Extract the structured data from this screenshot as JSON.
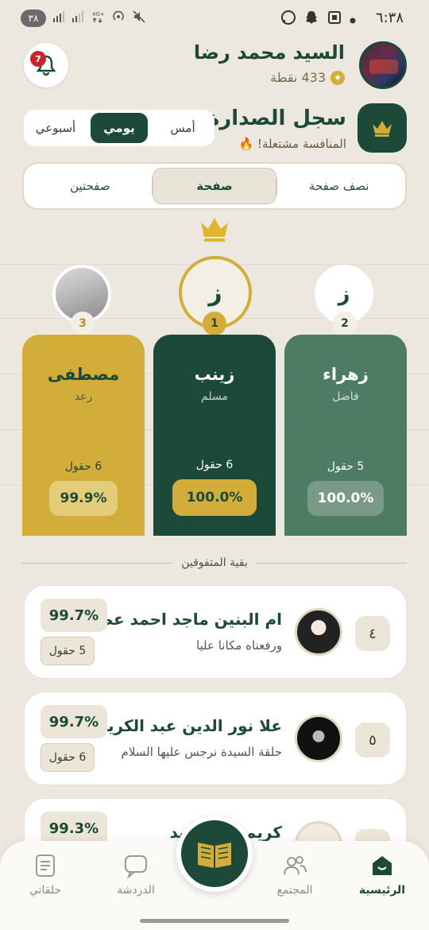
{
  "status_bar": {
    "time": "٦:٣٨",
    "battery": "٣٨"
  },
  "header": {
    "user_name": "السيد محمد رضا",
    "points": "433 نقطة",
    "notification_count": "7"
  },
  "leaderboard": {
    "title": "سجل الصدارة",
    "subtitle": "المنافسة مشتعلة! 🔥",
    "day_filters": [
      "أمس",
      "يومي",
      "أسبوعي"
    ],
    "day_active": "يومي",
    "amount_filters": [
      "نصف صفحة",
      "صفحة",
      "صفحتين"
    ],
    "amount_active": "صفحة"
  },
  "podium": [
    {
      "rank": "1",
      "initial": "ز",
      "name": "زينب",
      "circle": "مسلم",
      "fields": "6 حقول",
      "percent": "100.0%"
    },
    {
      "rank": "2",
      "initial": "ز",
      "name": "زهراء",
      "circle": "فاضل",
      "fields": "5 حقول",
      "percent": "100.0%"
    },
    {
      "rank": "3",
      "initial": "",
      "name": "مصطفى",
      "circle": "رعد",
      "fields": "6 حقول",
      "percent": "99.9%"
    }
  ],
  "rest_label": "بقية المتفوقين",
  "list": [
    {
      "rank": "٤",
      "name": "ام البنين ماجد احمد عطية",
      "circle": "ورفعناه مكانا عليا",
      "percent": "99.7%",
      "fields": "5 حقول"
    },
    {
      "rank": "٥",
      "name": "علا نور الدين عبد الكريم ...",
      "circle": "حلقة السيدة نرجس عليها السلام",
      "percent": "99.7%",
      "fields": "6 حقول"
    },
    {
      "rank": "",
      "name": "كريمة ... حميد",
      "circle": "",
      "percent": "99.3%",
      "fields": ""
    }
  ],
  "nav": {
    "home": "الرئيسية",
    "community": "المجتمع",
    "chat": "الدردشة",
    "my_circles": "حلقاتي"
  },
  "colors": {
    "primary": "#1d4a38",
    "gold": "#d3ad3a",
    "second": "#4d7b63",
    "background": "#ede8df"
  }
}
